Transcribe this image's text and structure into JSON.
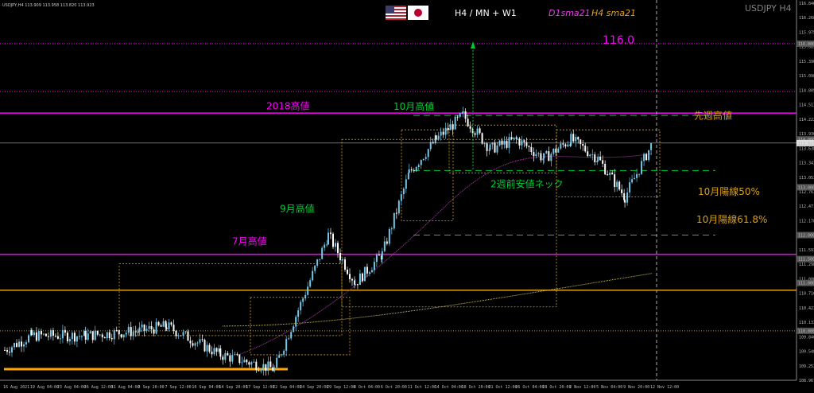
{
  "header": {
    "symbol_info": "USDJPY,H4  113.909 113.958 113.820 113.923",
    "timeframes": "H4 / MN + W1",
    "sma_d1": "D1sma21",
    "sma_h4": "H4 sma21",
    "symbol_watermark": "USDJPY H4"
  },
  "flags": [
    {
      "name": "us-flag",
      "colors": [
        "#b22234",
        "#ffffff",
        "#3c3b6e"
      ]
    },
    {
      "name": "japan-flag",
      "colors": [
        "#ffffff",
        "#bc002d"
      ]
    }
  ],
  "colors": {
    "background": "#000000",
    "bull": "#74c6e8",
    "bear": "#ffffff",
    "magenta": "#ff00ff",
    "green": "#00cc33",
    "gold": "#d9a012",
    "orange": "#ffa500",
    "price_line": "#dddddd"
  },
  "chart_data": {
    "type": "candlestick",
    "ylim": [
      108.967,
      116.846
    ],
    "price_axis": [
      "116.846",
      "116.268",
      "115.975",
      "115.683",
      "115.390",
      "115.098",
      "114.805",
      "114.513",
      "114.222",
      "113.930",
      "113.638",
      "113.343",
      "113.053",
      "112.763",
      "112.471",
      "112.178",
      "111.885",
      "111.593",
      "111.298",
      "111.000",
      "110.716",
      "110.423",
      "110.133",
      "109.840",
      "109.548",
      "109.253",
      "108.967"
    ],
    "price_badges": [
      "116.000",
      "114.000",
      "113.923",
      "113.000",
      "112.000",
      "111.500",
      "111.000",
      "110.000"
    ],
    "current_price": 113.923,
    "time_axis": [
      "16 Aug 2021",
      "19 Aug 04:00",
      "23 Aug 04:00",
      "26 Aug 12:00",
      "31 Aug 04:00",
      "2 Sep 20:00",
      "7 Sep 12:00",
      "10 Sep 04:00",
      "14 Sep 20:00",
      "17 Sep 12:00",
      "22 Sep 04:00",
      "24 Sep 20:00",
      "29 Sep 12:00",
      "4 Oct 04:00",
      "6 Oct 20:00",
      "11 Oct 12:00",
      "14 Oct 04:00",
      "18 Oct 20:00",
      "21 Oct 12:00",
      "26 Oct 04:00",
      "28 Oct 20:00",
      "2 Nov 12:00",
      "5 Nov 04:00",
      "9 Nov 20:00",
      "12 Nov 12:00"
    ],
    "annotations": [
      {
        "text": "116.0",
        "price": 116.0,
        "color": "#ff00ff"
      },
      {
        "text": "2018高値",
        "price": 114.55,
        "color": "#ff00ff"
      },
      {
        "text": "10月高値",
        "price": 114.5,
        "color": "#00cc33"
      },
      {
        "text": "先週高値",
        "price": 114.4,
        "color": "#d9a012"
      },
      {
        "text": "2週前安値ネック",
        "price": 113.3,
        "color": "#00cc33"
      },
      {
        "text": "10月陽線50%",
        "price": 112.76,
        "color": "#d9a012"
      },
      {
        "text": "9月高値",
        "price": 112.2,
        "color": "#00cc33"
      },
      {
        "text": "10月陽線61.8%",
        "price": 112.22,
        "color": "#d9a012"
      },
      {
        "text": "7月高値",
        "price": 111.6,
        "color": "#ff00ff"
      }
    ],
    "horizontal_levels": [
      {
        "price": 116.0,
        "color": "#ff00ff",
        "style": "dotted"
      },
      {
        "price": 115.0,
        "color": "#ff00ff",
        "style": "dotted"
      },
      {
        "price": 114.55,
        "color": "#ff00ff",
        "style": "solid"
      },
      {
        "price": 114.5,
        "color": "#00cc33",
        "style": "dashed"
      },
      {
        "price": 113.35,
        "color": "#00cc33",
        "style": "dashed"
      },
      {
        "price": 112.0,
        "color": "#00cc33",
        "style": "dashed"
      },
      {
        "price": 111.6,
        "color": "#ff00ff",
        "style": "solid"
      },
      {
        "price": 110.85,
        "color": "#d9a012",
        "style": "solid"
      },
      {
        "price": 110.0,
        "color": "#d9a012",
        "style": "dotted"
      },
      {
        "price": 109.2,
        "color": "#ffa500",
        "style": "thick"
      }
    ],
    "candles_ohlc_key_points": [
      {
        "t": "16 Aug 2021",
        "price": 109.6
      },
      {
        "t": "19 Aug 04:00",
        "price": 109.9
      },
      {
        "t": "26 Aug 12:00",
        "price": 109.9
      },
      {
        "t": "2 Sep 20:00",
        "price": 110.0
      },
      {
        "t": "7 Sep 12:00",
        "price": 110.1
      },
      {
        "t": "14 Sep 20:00",
        "price": 109.5
      },
      {
        "t": "22 Sep 04:00",
        "price": 109.2
      },
      {
        "t": "29 Sep 12:00",
        "price": 112.0
      },
      {
        "t": "4 Oct 04:00",
        "price": 111.0
      },
      {
        "t": "6 Oct 20:00",
        "price": 111.6
      },
      {
        "t": "11 Oct 12:00",
        "price": 113.3
      },
      {
        "t": "14 Oct 04:00",
        "price": 114.0
      },
      {
        "t": "18 Oct 20:00",
        "price": 114.5
      },
      {
        "t": "21 Oct 12:00",
        "price": 113.8
      },
      {
        "t": "26 Oct 04:00",
        "price": 114.0
      },
      {
        "t": "28 Oct 20:00",
        "price": 113.6
      },
      {
        "t": "2 Nov 12:00",
        "price": 114.0
      },
      {
        "t": "5 Nov 04:00",
        "price": 113.6
      },
      {
        "t": "9 Nov 20:00",
        "price": 112.8
      },
      {
        "t": "12 Nov 12:00",
        "price": 113.9
      }
    ]
  }
}
